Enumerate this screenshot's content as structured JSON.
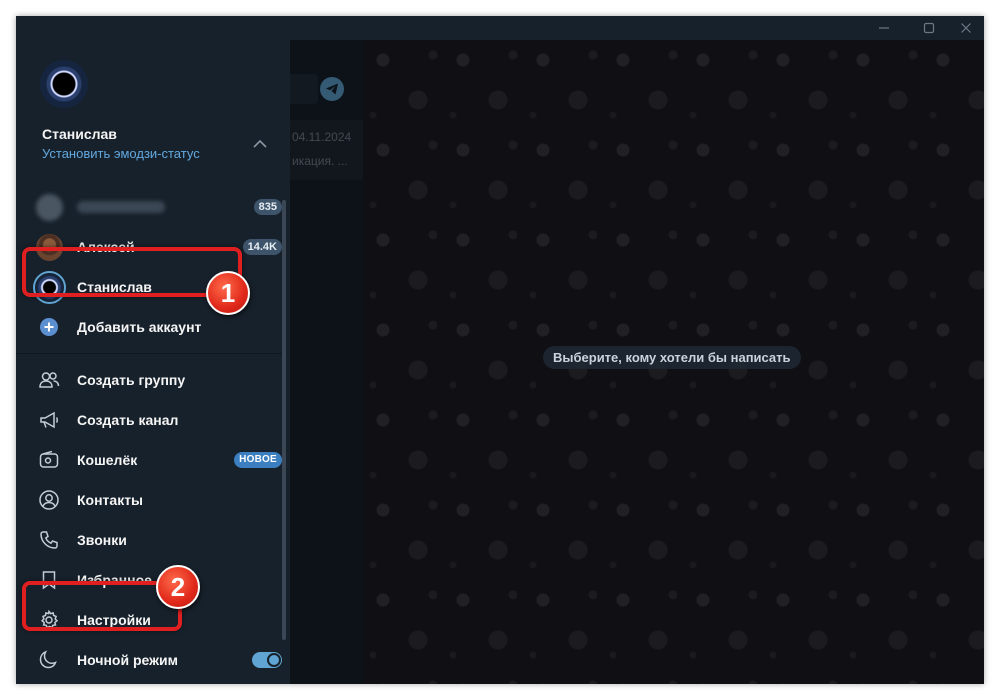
{
  "titlebar": {
    "controls": [
      {
        "name": "minimize-icon"
      },
      {
        "name": "maximize-icon"
      },
      {
        "name": "close-icon"
      }
    ]
  },
  "chatlist": {
    "date": "04.11.2024",
    "preview": "икация. ..."
  },
  "chat_area": {
    "empty_hint": "Выберите, кому хотели бы написать"
  },
  "menu": {
    "profile": {
      "name": "Станислав",
      "status_link": "Установить эмодзи-статус"
    },
    "accounts": [
      {
        "id": "hidden",
        "label": "",
        "badge": "835"
      },
      {
        "id": "aleksey",
        "label": "Алексей",
        "badge": "14.4K"
      },
      {
        "id": "stanislav",
        "label": "Станислав",
        "badge": ""
      }
    ],
    "add_account": "Добавить аккаунт",
    "items": [
      {
        "id": "create-group",
        "label": "Создать группу",
        "icon": "group-icon"
      },
      {
        "id": "create-channel",
        "label": "Создать канал",
        "icon": "megaphone-icon"
      },
      {
        "id": "wallet",
        "label": "Кошелёк",
        "icon": "wallet-icon",
        "badge": "НОВОЕ"
      },
      {
        "id": "contacts",
        "label": "Контакты",
        "icon": "contact-icon"
      },
      {
        "id": "calls",
        "label": "Звонки",
        "icon": "phone-icon"
      },
      {
        "id": "saved",
        "label": "Избранное",
        "icon": "bookmark-icon"
      },
      {
        "id": "settings",
        "label": "Настройки",
        "icon": "gear-icon"
      },
      {
        "id": "night-mode",
        "label": "Ночной режим",
        "icon": "moon-icon",
        "toggle_on": true
      }
    ]
  },
  "annotations": [
    {
      "number": "1",
      "target": "account-stanislav"
    },
    {
      "number": "2",
      "target": "settings"
    }
  ],
  "colors": {
    "menu_bg": "#17212b",
    "accent": "#5fa4d3",
    "link": "#62a9e0",
    "highlight": "#e02020"
  }
}
